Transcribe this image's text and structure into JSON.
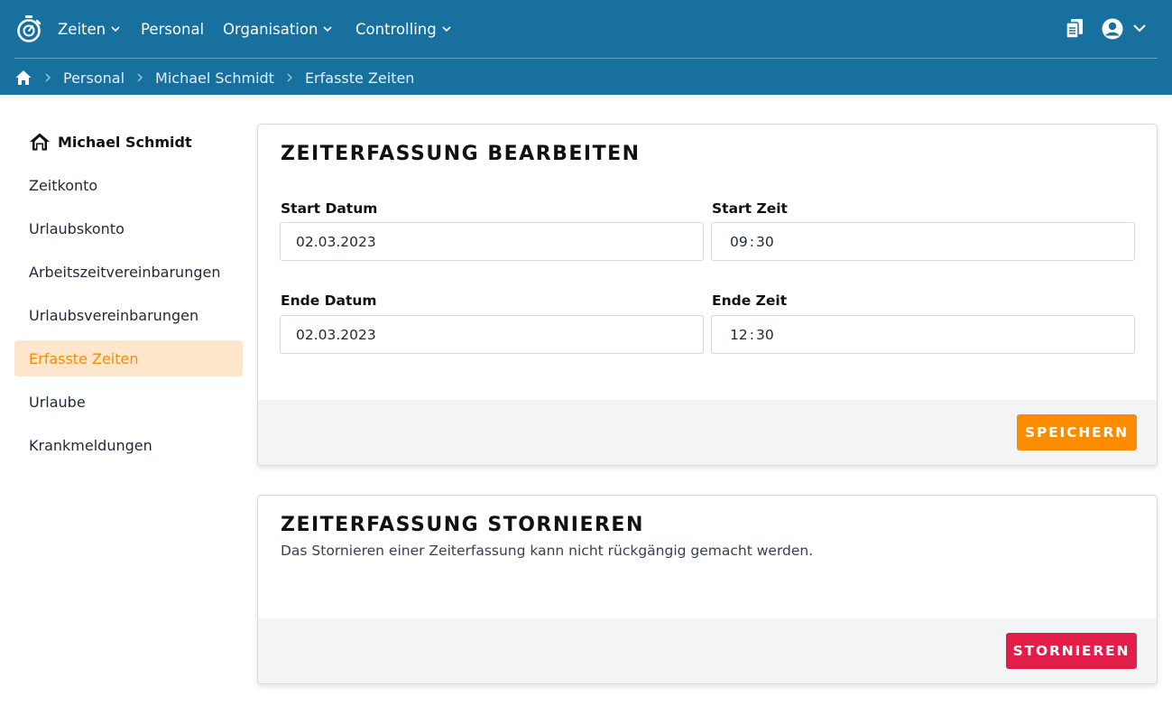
{
  "header": {
    "nav": [
      {
        "label": "Zeiten",
        "has_dropdown": true
      },
      {
        "label": "Personal",
        "has_dropdown": false
      },
      {
        "label": "Organisation",
        "has_dropdown": true
      },
      {
        "label": "Controlling",
        "has_dropdown": true
      }
    ],
    "icons": [
      "stopwatch-logo-icon",
      "documents-icon",
      "user-avatar-icon",
      "chevron-down-icon"
    ],
    "colors": {
      "header_bg": "#18709f",
      "accent": "#fb8c00",
      "danger": "#e11d48",
      "active_bg": "#fde6cc"
    }
  },
  "breadcrumb": {
    "items": [
      "Personal",
      "Michael Schmidt",
      "Erfasste Zeiten"
    ]
  },
  "sidebar": {
    "title": "Michael Schmidt",
    "items": [
      {
        "label": "Zeitkonto",
        "active": false
      },
      {
        "label": "Urlaubskonto",
        "active": false
      },
      {
        "label": "Arbeitszeitvereinbarungen",
        "active": false
      },
      {
        "label": "Urlaubsvereinbarungen",
        "active": false
      },
      {
        "label": "Erfasste Zeiten",
        "active": true
      },
      {
        "label": "Urlaube",
        "active": false
      },
      {
        "label": "Krankmeldungen",
        "active": false
      }
    ]
  },
  "edit": {
    "title": "ZEITERFASSUNG BEARBEITEN",
    "start_date_label": "Start Datum",
    "start_date_value": "02.03.2023",
    "start_time_label": "Start Zeit",
    "start_time_hours": "09",
    "start_time_minutes": "30",
    "end_date_label": "Ende Datum",
    "end_date_value": "02.03.2023",
    "end_time_label": "Ende Zeit",
    "end_time_hours": "12",
    "end_time_minutes": "30",
    "time_separator": ":",
    "save_label": "SPEICHERN"
  },
  "cancel": {
    "title": "ZEITERFASSUNG STORNIEREN",
    "description": "Das Stornieren einer Zeiterfassung kann nicht rückgängig gemacht werden.",
    "button_label": "STORNIEREN"
  }
}
